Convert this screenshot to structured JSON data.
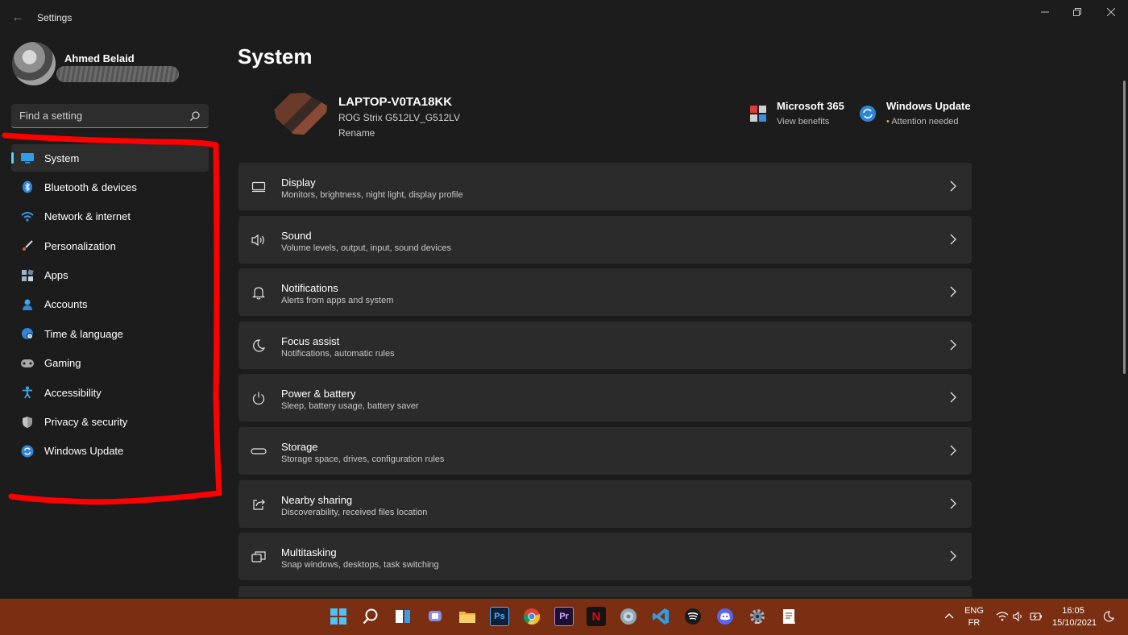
{
  "window": {
    "title": "Settings"
  },
  "profile": {
    "name": "Ahmed Belaid"
  },
  "search": {
    "placeholder": "Find a setting"
  },
  "sidebar": {
    "items": [
      {
        "label": "System",
        "icon": "monitor-icon",
        "active": true
      },
      {
        "label": "Bluetooth & devices",
        "icon": "bluetooth-icon"
      },
      {
        "label": "Network & internet",
        "icon": "wifi-icon"
      },
      {
        "label": "Personalization",
        "icon": "brush-icon"
      },
      {
        "label": "Apps",
        "icon": "apps-icon"
      },
      {
        "label": "Accounts",
        "icon": "person-icon"
      },
      {
        "label": "Time & language",
        "icon": "globe-clock-icon"
      },
      {
        "label": "Gaming",
        "icon": "gamepad-icon"
      },
      {
        "label": "Accessibility",
        "icon": "accessibility-icon"
      },
      {
        "label": "Privacy & security",
        "icon": "shield-icon"
      },
      {
        "label": "Windows Update",
        "icon": "update-icon"
      }
    ]
  },
  "main": {
    "title": "System",
    "device": {
      "name": "LAPTOP-V0TA18KK",
      "model": "ROG Strix G512LV_G512LV",
      "rename": "Rename"
    },
    "quick_links": [
      {
        "title": "Microsoft 365",
        "subtitle": "View benefits",
        "icon": "microsoft365-icon"
      },
      {
        "title": "Windows Update",
        "subtitle": "Attention needed",
        "icon": "update-icon"
      }
    ],
    "cards": [
      {
        "title": "Display",
        "subtitle": "Monitors, brightness, night light, display profile",
        "icon": "display-icon"
      },
      {
        "title": "Sound",
        "subtitle": "Volume levels, output, input, sound devices",
        "icon": "speaker-icon"
      },
      {
        "title": "Notifications",
        "subtitle": "Alerts from apps and system",
        "icon": "bell-icon"
      },
      {
        "title": "Focus assist",
        "subtitle": "Notifications, automatic rules",
        "icon": "moon-icon"
      },
      {
        "title": "Power & battery",
        "subtitle": "Sleep, battery usage, battery saver",
        "icon": "power-icon"
      },
      {
        "title": "Storage",
        "subtitle": "Storage space, drives, configuration rules",
        "icon": "storage-icon"
      },
      {
        "title": "Nearby sharing",
        "subtitle": "Discoverability, received files location",
        "icon": "share-icon"
      },
      {
        "title": "Multitasking",
        "subtitle": "Snap windows, desktops, task switching",
        "icon": "multitask-icon"
      }
    ]
  },
  "taskbar": {
    "photoshop_label": "Ps",
    "premiere_label": "Pr",
    "netflix_label": "N",
    "language_top": "ENG",
    "language_bottom": "FR",
    "time": "16:05",
    "date": "15/10/2021"
  },
  "colors": {
    "accent": "#60cdff",
    "taskbar": "#7a2f12",
    "background": "#1c1c1c",
    "card": "#2b2b2b",
    "annotation": "#ff0000"
  }
}
